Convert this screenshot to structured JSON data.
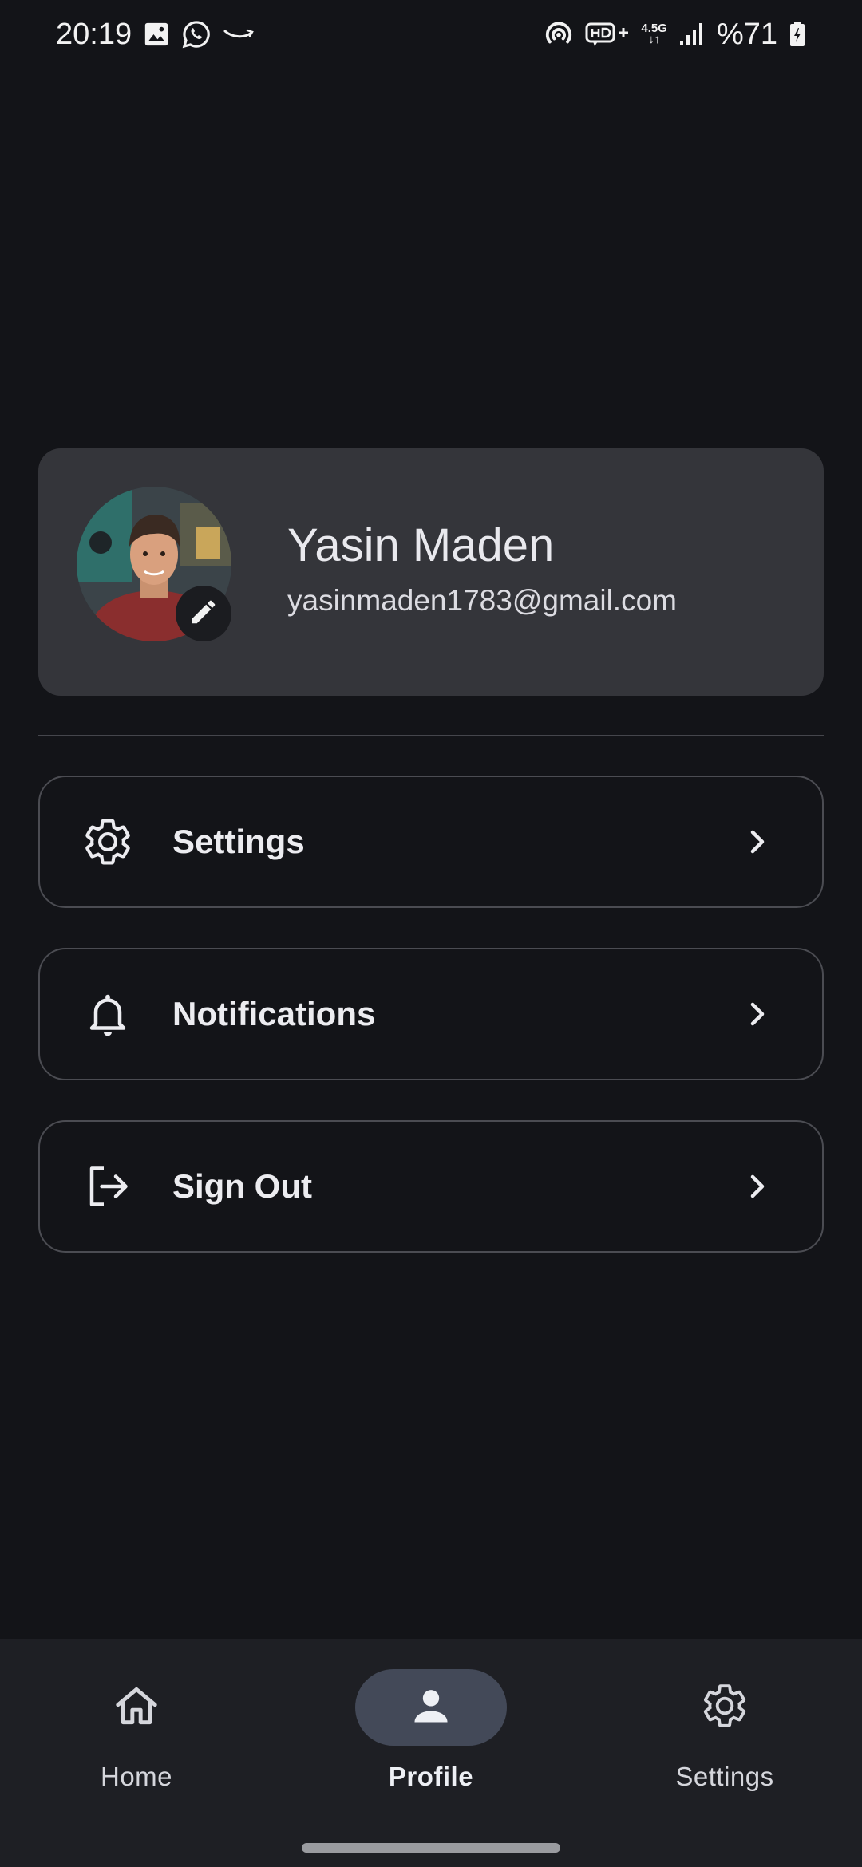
{
  "status_bar": {
    "time": "20:19",
    "battery": "%71",
    "network": "4.5G",
    "left_icons": [
      "image-icon",
      "whatsapp-icon",
      "amazon-icon"
    ],
    "right_icons": [
      "hotspot-icon",
      "hd-voice-icon",
      "network-4.5g-icon",
      "signal-icon",
      "battery-charging-icon"
    ]
  },
  "profile": {
    "name": "Yasin Maden",
    "email": "yasinmaden1783@gmail.com",
    "edit_icon": "pencil-icon"
  },
  "menu": {
    "items": [
      {
        "label": "Settings",
        "icon": "gear-icon"
      },
      {
        "label": "Notifications",
        "icon": "bell-icon"
      },
      {
        "label": "Sign Out",
        "icon": "sign-out-icon"
      }
    ]
  },
  "bottom_nav": {
    "items": [
      {
        "label": "Home",
        "icon": "home-icon",
        "active": false
      },
      {
        "label": "Profile",
        "icon": "person-icon",
        "active": true
      },
      {
        "label": "Settings",
        "icon": "gear-icon",
        "active": false
      }
    ]
  },
  "colors": {
    "background": "#131418",
    "card": "#34353a",
    "nav_background": "#1e1f24",
    "active_pill": "#434958",
    "text": "#e6e6ea"
  }
}
